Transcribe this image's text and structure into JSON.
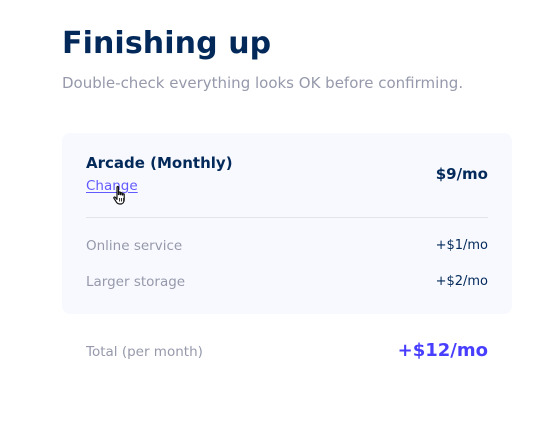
{
  "header": {
    "title": "Finishing up",
    "subtitle": "Double-check everything looks OK before confirming."
  },
  "summary": {
    "plan": {
      "name": "Arcade (Monthly)",
      "change_label": "Change",
      "price": "$9/mo"
    },
    "addons": [
      {
        "name": "Online service",
        "price": "+$1/mo"
      },
      {
        "name": "Larger storage",
        "price": "+$2/mo"
      }
    ]
  },
  "total": {
    "label": "Total (per month)",
    "price": "+$12/mo"
  },
  "icons": {
    "cursor": "hand-pointer-icon"
  },
  "colors": {
    "primary_text": "#02295a",
    "muted_text": "#9699ab",
    "accent": "#483eff",
    "card_background": "#f8f9fe"
  }
}
